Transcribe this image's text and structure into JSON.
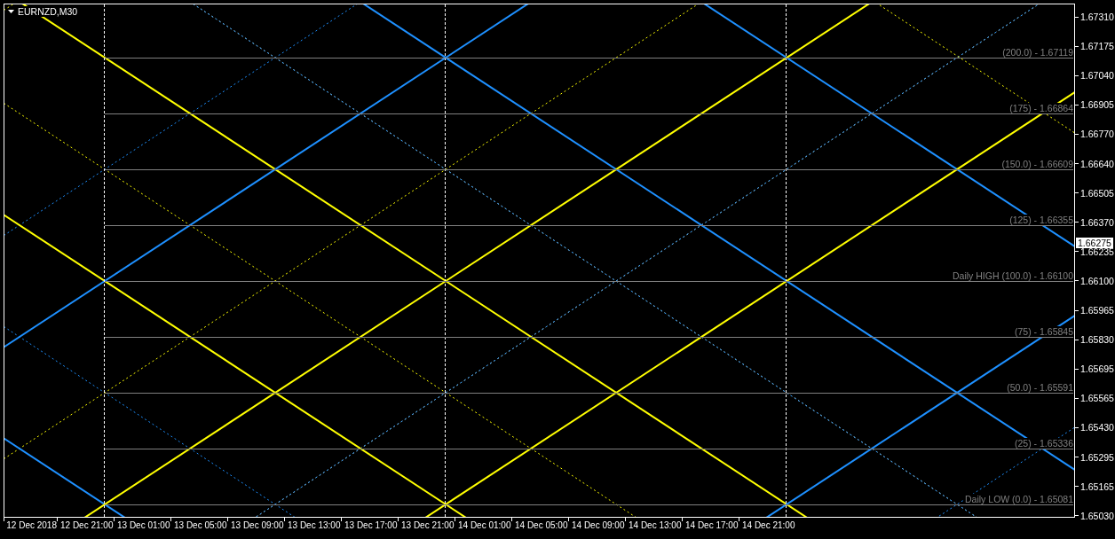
{
  "chart": {
    "title": "EURNZD,M30",
    "levels": [
      {
        "label": "(200.0) - 1.67119"
      },
      {
        "label": "(175) - 1.66864"
      },
      {
        "label": "(150.0) - 1.66609"
      },
      {
        "label": "(125) - 1.66355"
      },
      {
        "label": "Daily HIGH (100.0) - 1.66100"
      },
      {
        "label": "(75) - 1.65845"
      },
      {
        "label": "(50.0) - 1.65591"
      },
      {
        "label": "(25) - 1.65336"
      },
      {
        "label": "Daily LOW (0.0) - 1.65081"
      }
    ],
    "price_axis": [
      "1.67310",
      "1.67175",
      "1.67040",
      "1.66905",
      "1.66770",
      "1.66640",
      "1.66505",
      "1.66370",
      "1.66235",
      "1.66100",
      "1.65965",
      "1.65830",
      "1.65695",
      "1.65565",
      "1.65430",
      "1.65295",
      "1.65165",
      "1.65030"
    ],
    "current_price": "1.66275",
    "time_axis": [
      "12 Dec 2018",
      "12 Dec 21:00",
      "13 Dec 01:00",
      "13 Dec 05:00",
      "13 Dec 09:00",
      "13 Dec 13:00",
      "13 Dec 17:00",
      "13 Dec 21:00",
      "14 Dec 01:00",
      "14 Dec 05:00",
      "14 Dec 09:00",
      "14 Dec 13:00",
      "14 Dec 17:00",
      "14 Dec 21:00"
    ]
  }
}
